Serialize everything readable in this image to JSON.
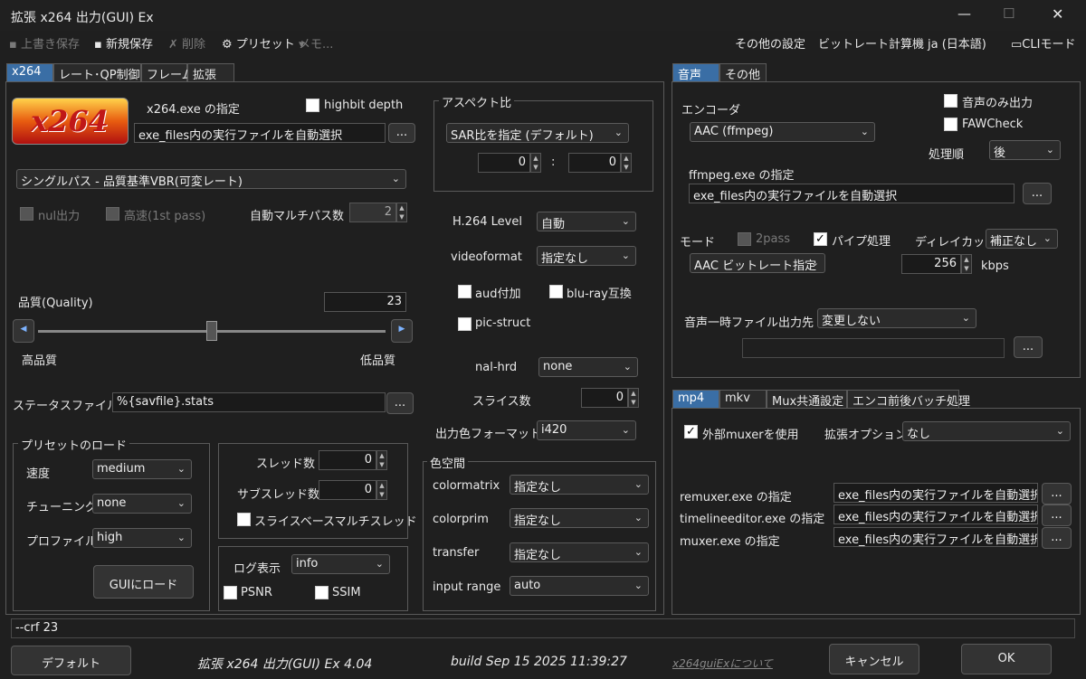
{
  "window": {
    "title": "拡張 x264 出力(GUI) Ex",
    "min": "—",
    "max": "☐",
    "close": "✕"
  },
  "toolbar": {
    "overwrite_save": "上書き保存",
    "new_save": "新規保存",
    "delete": "削除",
    "preset": "プリセット",
    "memo": "メモ...",
    "other_settings": "その他の設定",
    "bitrate_calc": "ビットレート計算機",
    "language": "ja (日本語)",
    "cli_mode": "CLIモード"
  },
  "left_tabs": [
    "x264",
    "レート･QP制御",
    "フレーム",
    "拡張"
  ],
  "x264": {
    "exe_label": "x264.exe の指定",
    "highbit_depth": "highbit depth",
    "exe_path": "exe_files内の実行ファイルを自動選択",
    "browse": "...",
    "mode": "シングルパス - 品質基準VBR(可変レート)",
    "nul_output": "nul出力",
    "fast_first_pass": "高速(1st pass)",
    "auto_multipass": "自動マルチパス数",
    "auto_multipass_value": "2",
    "quality_label": "品質(Quality)",
    "quality_value": "23",
    "quality_ratio": 0.5,
    "high_quality": "高品質",
    "low_quality": "低品質",
    "status_file_label": "ステータスファイル",
    "status_file": "%{savfile}.stats",
    "aspect_group": "アスペクト比",
    "sar_mode": "SAR比を指定 (デフォルト)",
    "sar_x": "0",
    "sar_sep": ":",
    "sar_y": "0",
    "level_label": "H.264 Level",
    "level": "自動",
    "videoformat_label": "videoformat",
    "videoformat": "指定なし",
    "aud": "aud付加",
    "bluray": "blu-ray互換",
    "pic_struct": "pic-struct",
    "nalhrd_label": "nal-hrd",
    "nalhrd": "none",
    "slices_label": "スライス数",
    "slices": "0",
    "out_color_label": "出力色フォーマット",
    "out_color": "i420",
    "preset_group": "プリセットのロード",
    "speed_label": "速度",
    "speed": "medium",
    "tuning_label": "チューニング",
    "tuning": "none",
    "profile_label": "プロファイル",
    "profile": "high",
    "load_gui": "GUIにロード",
    "threads_label": "スレッド数",
    "threads": "0",
    "subthreads_label": "サブスレッド数",
    "subthreads": "0",
    "slice_threads": "スライスベースマルチスレッド",
    "log_label": "ログ表示",
    "log": "info",
    "psnr": "PSNR",
    "ssim": "SSIM",
    "colorspace_group": "色空間",
    "colormatrix_label": "colormatrix",
    "colormatrix": "指定なし",
    "colorprim_label": "colorprim",
    "colorprim": "指定なし",
    "transfer_label": "transfer",
    "transfer": "指定なし",
    "input_range_label": "input range",
    "input_range": "auto"
  },
  "audio_tabs": [
    "音声",
    "その他"
  ],
  "audio": {
    "encoder_label": "エンコーダ",
    "encoder": "AAC (ffmpeg)",
    "audio_only": "音声のみ出力",
    "faw_check": "FAWCheck",
    "order_label": "処理順",
    "order": "後",
    "ffmpeg_label": "ffmpeg.exe の指定",
    "ffmpeg_path": "exe_files内の実行ファイルを自動選択",
    "browse": "...",
    "mode_label": "モード",
    "twopass": "2pass",
    "pipe": "パイプ処理",
    "delay_label": "ディレイカット",
    "delay": "補正なし",
    "aac_mode": "AAC ビットレート指定",
    "bitrate": "256",
    "kbps": "kbps",
    "temp_label": "音声一時ファイル出力先",
    "temp": "変更しない",
    "temp_path": ""
  },
  "mux_tabs": [
    "mp4",
    "mkv",
    "Mux共通設定",
    "エンコ前後バッチ処理"
  ],
  "mux": {
    "use_external": "外部muxerを使用",
    "ext_option_label": "拡張オプション",
    "ext_option": "なし",
    "remuxer_label": "remuxer.exe の指定",
    "remuxer": "exe_files内の実行ファイルを自動選択",
    "timeline_label": "timelineeditor.exe の指定",
    "timeline": "exe_files内の実行ファイルを自動選択",
    "muxer_label": "muxer.exe の指定",
    "muxer": "exe_files内の実行ファイルを自動選択",
    "browse": "..."
  },
  "cmdline": "--crf 23",
  "footer": {
    "default": "デフォルト",
    "product": "拡張 x264 出力(GUI) Ex 4.04",
    "build": "build Sep 15 2025 11:39:27",
    "about": "x264guiExについて",
    "cancel": "キャンセル",
    "ok": "OK"
  }
}
